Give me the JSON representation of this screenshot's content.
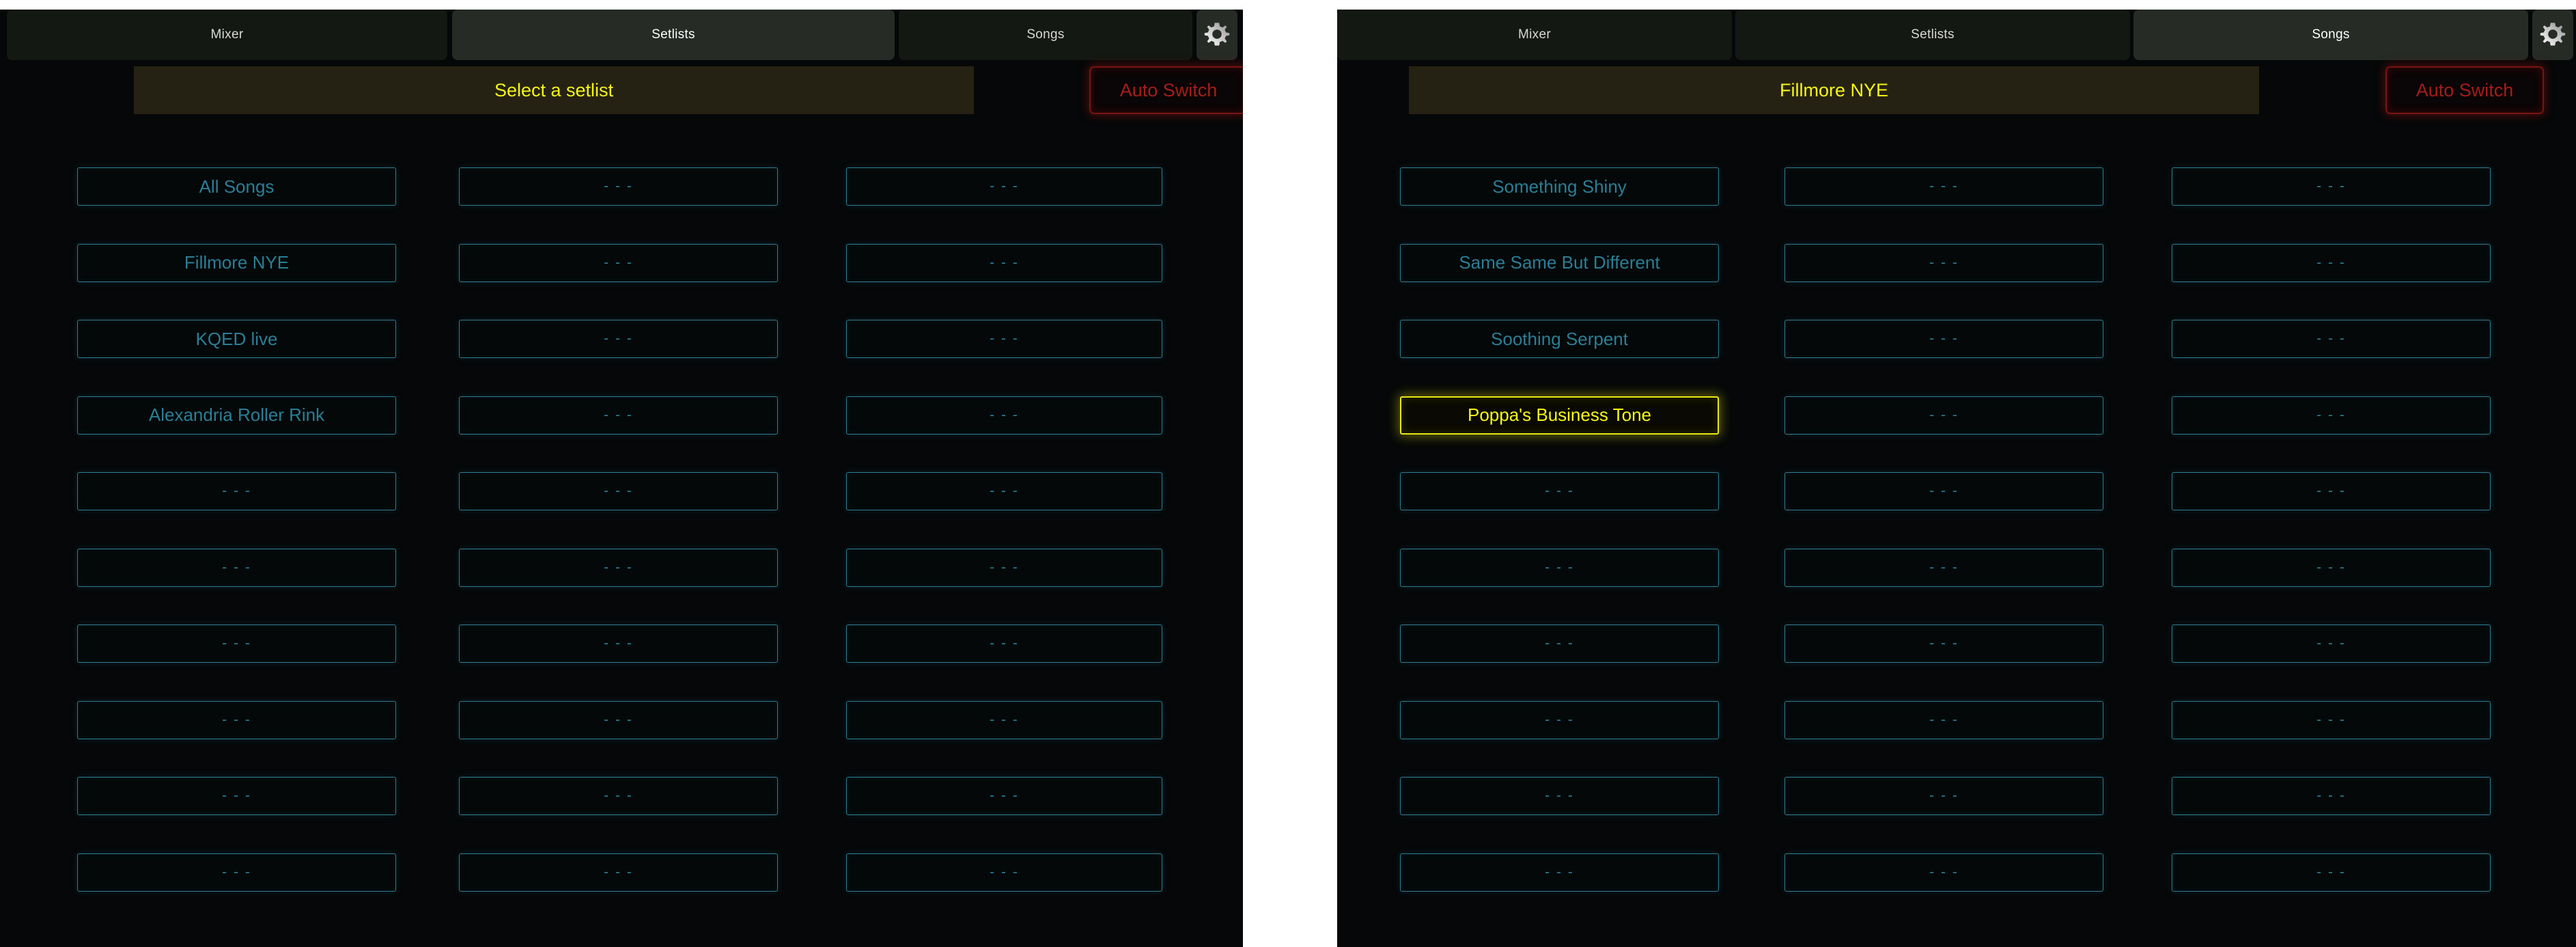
{
  "colors": {
    "accent_cyan": "#2b7e96",
    "accent_yellow": "#f5f516",
    "accent_red": "#a51d1a",
    "panel_bg": "#050708",
    "tab_bg": "#141812",
    "tab_active_bg": "#262b26",
    "title_bg": "#262213"
  },
  "placeholder": "- - -",
  "panels": [
    {
      "id": "left",
      "tabs": [
        {
          "label": "Mixer",
          "active": false
        },
        {
          "label": "Setlists",
          "active": true
        },
        {
          "label": "Songs",
          "active": false
        }
      ],
      "settings_icon": "gear-icon",
      "title": "Select a setlist",
      "auto_switch": {
        "label": "Auto Switch",
        "enabled": false
      },
      "columns": [
        {
          "items": [
            {
              "label": "All Songs",
              "empty": false,
              "selected": false
            },
            {
              "label": "Fillmore NYE",
              "empty": false,
              "selected": false
            },
            {
              "label": "KQED live",
              "empty": false,
              "selected": false
            },
            {
              "label": "Alexandria Roller Rink",
              "empty": false,
              "selected": false
            },
            {
              "label": "- - -",
              "empty": true,
              "selected": false
            },
            {
              "label": "- - -",
              "empty": true,
              "selected": false
            },
            {
              "label": "- - -",
              "empty": true,
              "selected": false
            },
            {
              "label": "- - -",
              "empty": true,
              "selected": false
            },
            {
              "label": "- - -",
              "empty": true,
              "selected": false
            },
            {
              "label": "- - -",
              "empty": true,
              "selected": false
            }
          ]
        },
        {
          "items": [
            {
              "label": "- - -",
              "empty": true,
              "selected": false
            },
            {
              "label": "- - -",
              "empty": true,
              "selected": false
            },
            {
              "label": "- - -",
              "empty": true,
              "selected": false
            },
            {
              "label": "- - -",
              "empty": true,
              "selected": false
            },
            {
              "label": "- - -",
              "empty": true,
              "selected": false
            },
            {
              "label": "- - -",
              "empty": true,
              "selected": false
            },
            {
              "label": "- - -",
              "empty": true,
              "selected": false
            },
            {
              "label": "- - -",
              "empty": true,
              "selected": false
            },
            {
              "label": "- - -",
              "empty": true,
              "selected": false
            },
            {
              "label": "- - -",
              "empty": true,
              "selected": false
            }
          ]
        },
        {
          "items": [
            {
              "label": "- - -",
              "empty": true,
              "selected": false
            },
            {
              "label": "- - -",
              "empty": true,
              "selected": false
            },
            {
              "label": "- - -",
              "empty": true,
              "selected": false
            },
            {
              "label": "- - -",
              "empty": true,
              "selected": false
            },
            {
              "label": "- - -",
              "empty": true,
              "selected": false
            },
            {
              "label": "- - -",
              "empty": true,
              "selected": false
            },
            {
              "label": "- - -",
              "empty": true,
              "selected": false
            },
            {
              "label": "- - -",
              "empty": true,
              "selected": false
            },
            {
              "label": "- - -",
              "empty": true,
              "selected": false
            },
            {
              "label": "- - -",
              "empty": true,
              "selected": false
            }
          ]
        }
      ]
    },
    {
      "id": "right",
      "tabs": [
        {
          "label": "Mixer",
          "active": false
        },
        {
          "label": "Setlists",
          "active": false
        },
        {
          "label": "Songs",
          "active": true
        }
      ],
      "settings_icon": "gear-icon",
      "title": "Fillmore NYE",
      "auto_switch": {
        "label": "Auto Switch",
        "enabled": false
      },
      "columns": [
        {
          "items": [
            {
              "label": "Something Shiny",
              "empty": false,
              "selected": false
            },
            {
              "label": "Same Same But Different",
              "empty": false,
              "selected": false
            },
            {
              "label": "Soothing Serpent",
              "empty": false,
              "selected": false
            },
            {
              "label": "Poppa's Business Tone",
              "empty": false,
              "selected": true
            },
            {
              "label": "- - -",
              "empty": true,
              "selected": false
            },
            {
              "label": "- - -",
              "empty": true,
              "selected": false
            },
            {
              "label": "- - -",
              "empty": true,
              "selected": false
            },
            {
              "label": "- - -",
              "empty": true,
              "selected": false
            },
            {
              "label": "- - -",
              "empty": true,
              "selected": false
            },
            {
              "label": "- - -",
              "empty": true,
              "selected": false
            }
          ]
        },
        {
          "items": [
            {
              "label": "- - -",
              "empty": true,
              "selected": false
            },
            {
              "label": "- - -",
              "empty": true,
              "selected": false
            },
            {
              "label": "- - -",
              "empty": true,
              "selected": false
            },
            {
              "label": "- - -",
              "empty": true,
              "selected": false
            },
            {
              "label": "- - -",
              "empty": true,
              "selected": false
            },
            {
              "label": "- - -",
              "empty": true,
              "selected": false
            },
            {
              "label": "- - -",
              "empty": true,
              "selected": false
            },
            {
              "label": "- - -",
              "empty": true,
              "selected": false
            },
            {
              "label": "- - -",
              "empty": true,
              "selected": false
            },
            {
              "label": "- - -",
              "empty": true,
              "selected": false
            }
          ]
        },
        {
          "items": [
            {
              "label": "- - -",
              "empty": true,
              "selected": false
            },
            {
              "label": "- - -",
              "empty": true,
              "selected": false
            },
            {
              "label": "- - -",
              "empty": true,
              "selected": false
            },
            {
              "label": "- - -",
              "empty": true,
              "selected": false
            },
            {
              "label": "- - -",
              "empty": true,
              "selected": false
            },
            {
              "label": "- - -",
              "empty": true,
              "selected": false
            },
            {
              "label": "- - -",
              "empty": true,
              "selected": false
            },
            {
              "label": "- - -",
              "empty": true,
              "selected": false
            },
            {
              "label": "- - -",
              "empty": true,
              "selected": false
            },
            {
              "label": "- - -",
              "empty": true,
              "selected": false
            }
          ]
        }
      ]
    }
  ]
}
